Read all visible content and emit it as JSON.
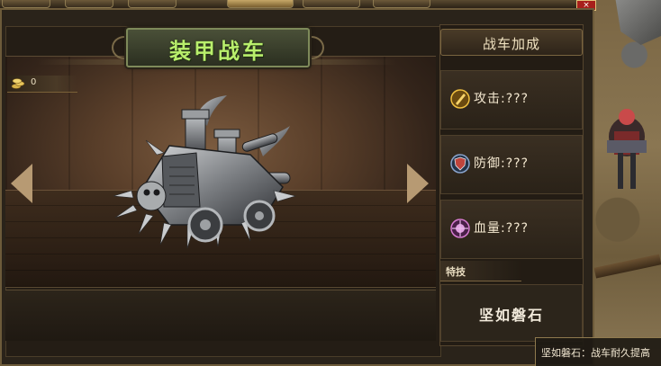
{
  "window": {
    "title": "装甲战车",
    "close_glyph": "×"
  },
  "currency": {
    "icon": "coin-stack-icon",
    "value": "0"
  },
  "nav": {
    "prev_icon": "left-arrow-icon",
    "next_icon": "right-arrow-icon"
  },
  "side_panel": {
    "header": "战车加成",
    "stats": [
      {
        "icon": "attack-sword-icon",
        "label": "攻击:???",
        "color": "#e0a820"
      },
      {
        "icon": "defense-shield-icon",
        "label": "防御:???",
        "color": "#5a7bb0"
      },
      {
        "icon": "hp-heart-icon",
        "label": "血量:???",
        "color": "#c05ab8"
      }
    ],
    "skill_header": "特技",
    "skill_name": "坚如磐石"
  },
  "tooltip": {
    "text": "坚如磐石：战车耐久提高"
  }
}
